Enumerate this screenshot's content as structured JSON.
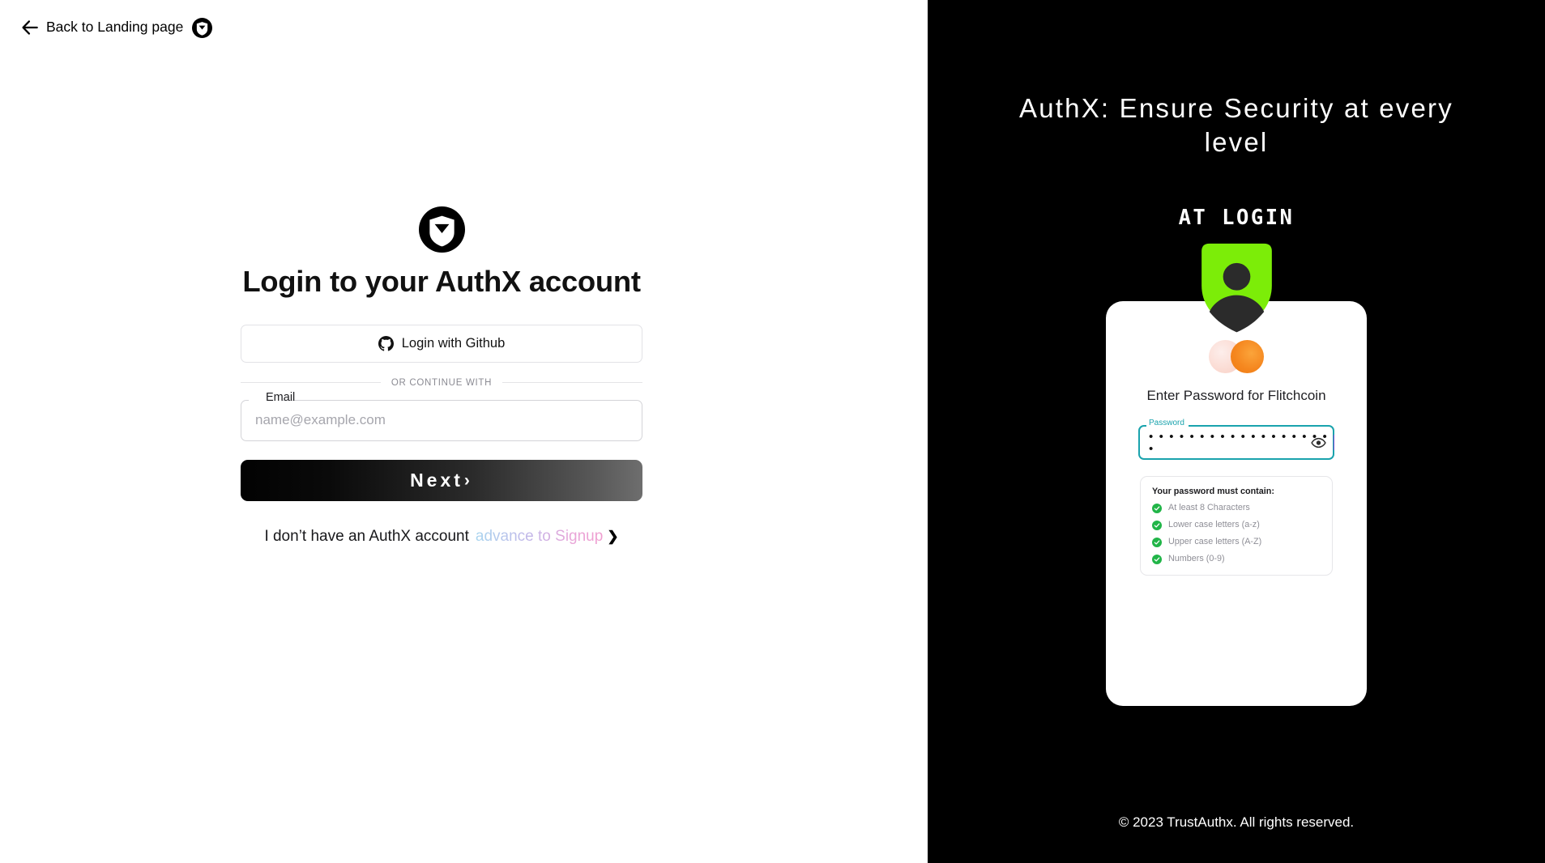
{
  "header": {
    "back_label": "Back to Landing page",
    "back_arrow_icon": "arrow-left-icon",
    "logo_icon": "authx-shield-logo"
  },
  "left": {
    "logo_icon": "authx-shield-logo",
    "title": "Login to your AuthX account",
    "github_button": {
      "label": "Login with Github",
      "icon": "github-icon"
    },
    "divider_text": "OR CONTINUE WITH",
    "email_field": {
      "label": "Email",
      "placeholder": "name@example.com",
      "value": ""
    },
    "next_button": {
      "label": "Next",
      "chevron": "›"
    },
    "signup": {
      "prompt": "I don’t have an AuthX account",
      "link": "advance to Signup",
      "chevron": "❯"
    }
  },
  "right": {
    "headline": "AuthX: Ensure Security at every level",
    "section_label": "AT LOGIN",
    "shield_icon": "shield-user-icon",
    "shield_color": "#7ced08",
    "card": {
      "brand_icon": "overlapping-circles-logo",
      "heading": "Enter Password for Flitchcoin",
      "password_field": {
        "label": "Password",
        "masked_value": "• • • • • • • • • • • • • • • • • • •",
        "toggle_icon": "eye-icon"
      },
      "requirements": {
        "title": "Your password must contain:",
        "items": [
          "At least 8 Characters",
          "Lower case letters (a-z)",
          "Upper case letters (A-Z)",
          "Numbers (0-9)"
        ],
        "check_icon": "check-circle-icon",
        "check_color": "#21b548"
      }
    },
    "copyright": "© 2023 TrustAuthx. All rights reserved."
  },
  "colors": {
    "panel_background": "#000000",
    "page_background": "#ffffff",
    "accent_green": "#7ced08",
    "focus_teal": "#1aa3ad"
  }
}
